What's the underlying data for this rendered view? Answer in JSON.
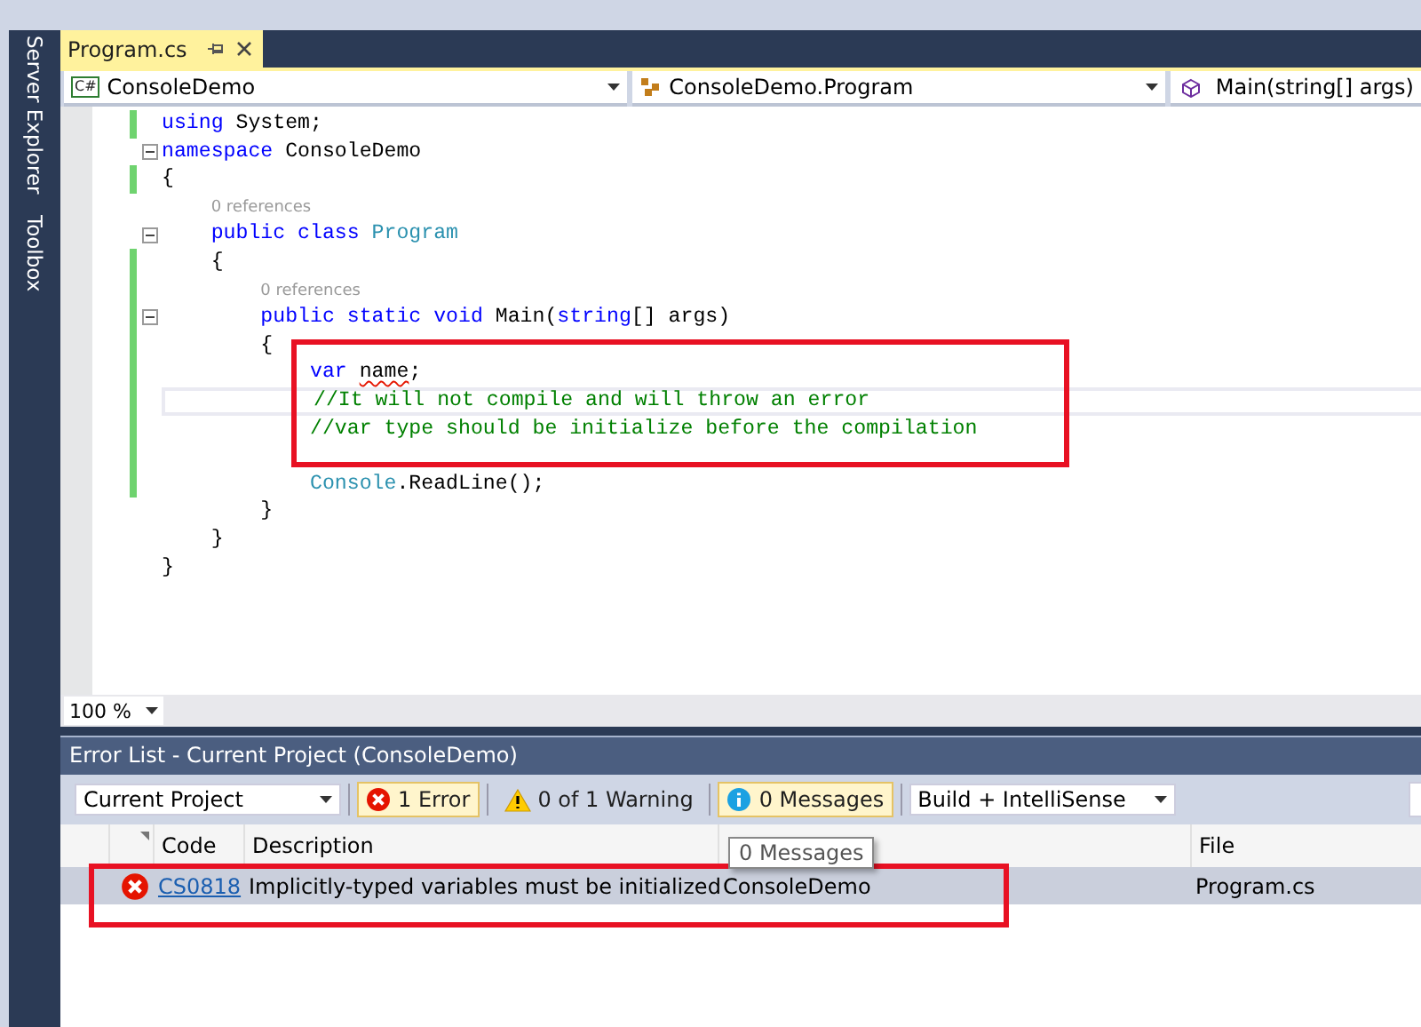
{
  "side_tabs": [
    {
      "label": "Server Explorer"
    },
    {
      "label": "Toolbox"
    }
  ],
  "document_tab": {
    "title": "Program.cs",
    "selected": true
  },
  "nav_bar": [
    {
      "kind": "project",
      "text": "ConsoleDemo",
      "badge": "C#"
    },
    {
      "kind": "class",
      "text": "ConsoleDemo.Program"
    },
    {
      "kind": "member",
      "text": "Main(string[] args)"
    }
  ],
  "code_lines": [
    {
      "changed": true,
      "fold": false,
      "current": false,
      "tokens": [
        {
          "kind": "keyword",
          "text": "using"
        },
        {
          "kind": "plain",
          "text": " System;"
        }
      ]
    },
    {
      "changed": false,
      "fold": true,
      "current": false,
      "tokens": [
        {
          "kind": "keyword",
          "text": "namespace"
        },
        {
          "kind": "plain",
          "text": " ConsoleDemo"
        }
      ]
    },
    {
      "changed": true,
      "fold": false,
      "current": false,
      "tokens": [
        {
          "kind": "plain",
          "text": "{"
        }
      ]
    },
    {
      "changed": false,
      "fold": false,
      "current": false,
      "tokens": [
        {
          "kind": "lens",
          "text": "    0 references"
        }
      ]
    },
    {
      "changed": false,
      "fold": true,
      "current": false,
      "tokens": [
        {
          "kind": "keyword",
          "text": "    public class "
        },
        {
          "kind": "type",
          "text": "Program"
        }
      ]
    },
    {
      "changed": true,
      "fold": false,
      "current": false,
      "tokens": [
        {
          "kind": "plain",
          "text": "    {"
        }
      ]
    },
    {
      "changed": true,
      "fold": false,
      "current": false,
      "tokens": [
        {
          "kind": "lens",
          "text": "        0 references"
        }
      ]
    },
    {
      "changed": true,
      "fold": true,
      "current": false,
      "tokens": [
        {
          "kind": "keyword",
          "text": "        public static void"
        },
        {
          "kind": "plain",
          "text": " Main("
        },
        {
          "kind": "keyword",
          "text": "string"
        },
        {
          "kind": "plain",
          "text": "[] args)"
        }
      ]
    },
    {
      "changed": true,
      "fold": false,
      "current": false,
      "tokens": [
        {
          "kind": "plain",
          "text": "        {"
        }
      ]
    },
    {
      "changed": true,
      "fold": false,
      "current": false,
      "tokens": [
        {
          "kind": "keyword",
          "text": "            var "
        },
        {
          "kind": "error",
          "text": "name"
        },
        {
          "kind": "plain",
          "text": ";"
        }
      ]
    },
    {
      "changed": true,
      "fold": false,
      "current": true,
      "tokens": [
        {
          "kind": "comment",
          "text": "            //It will not compile and will throw an error"
        }
      ]
    },
    {
      "changed": true,
      "fold": false,
      "current": false,
      "tokens": [
        {
          "kind": "comment",
          "text": "            //var type should be initialize before the compilation"
        }
      ]
    },
    {
      "changed": true,
      "fold": false,
      "current": false
    },
    {
      "changed": true,
      "fold": false,
      "current": false,
      "tokens": [
        {
          "kind": "type",
          "text": "            Console"
        },
        {
          "kind": "plain",
          "text": ".ReadLine();"
        }
      ]
    },
    {
      "changed": false,
      "fold": false,
      "current": false,
      "tokens": [
        {
          "kind": "plain",
          "text": "        }"
        }
      ]
    },
    {
      "changed": false,
      "fold": false,
      "current": false,
      "tokens": [
        {
          "kind": "plain",
          "text": "    }"
        }
      ]
    },
    {
      "changed": false,
      "fold": false,
      "current": false,
      "tokens": [
        {
          "kind": "plain",
          "text": "}"
        }
      ]
    }
  ],
  "zoom": "100 %",
  "error_list": {
    "title": "Error List - Current Project (ConsoleDemo)",
    "scope": "Current Project",
    "filters": [
      {
        "kind": "error",
        "label": "1 Error",
        "selected": true
      },
      {
        "kind": "warning",
        "label": "0 of 1 Warning",
        "selected": false
      },
      {
        "kind": "info",
        "label": "0 Messages",
        "selected": true
      }
    ],
    "source": "Build + IntelliSense",
    "columns": [
      "",
      "Code",
      "Description",
      "",
      "File"
    ],
    "rows": [
      {
        "kind": "error",
        "selected": true,
        "code": "CS0818",
        "description": "Implicitly-typed variables must be initialized",
        "project": "ConsoleDemo",
        "file": "Program.cs"
      }
    ],
    "tooltip": "0 Messages"
  }
}
